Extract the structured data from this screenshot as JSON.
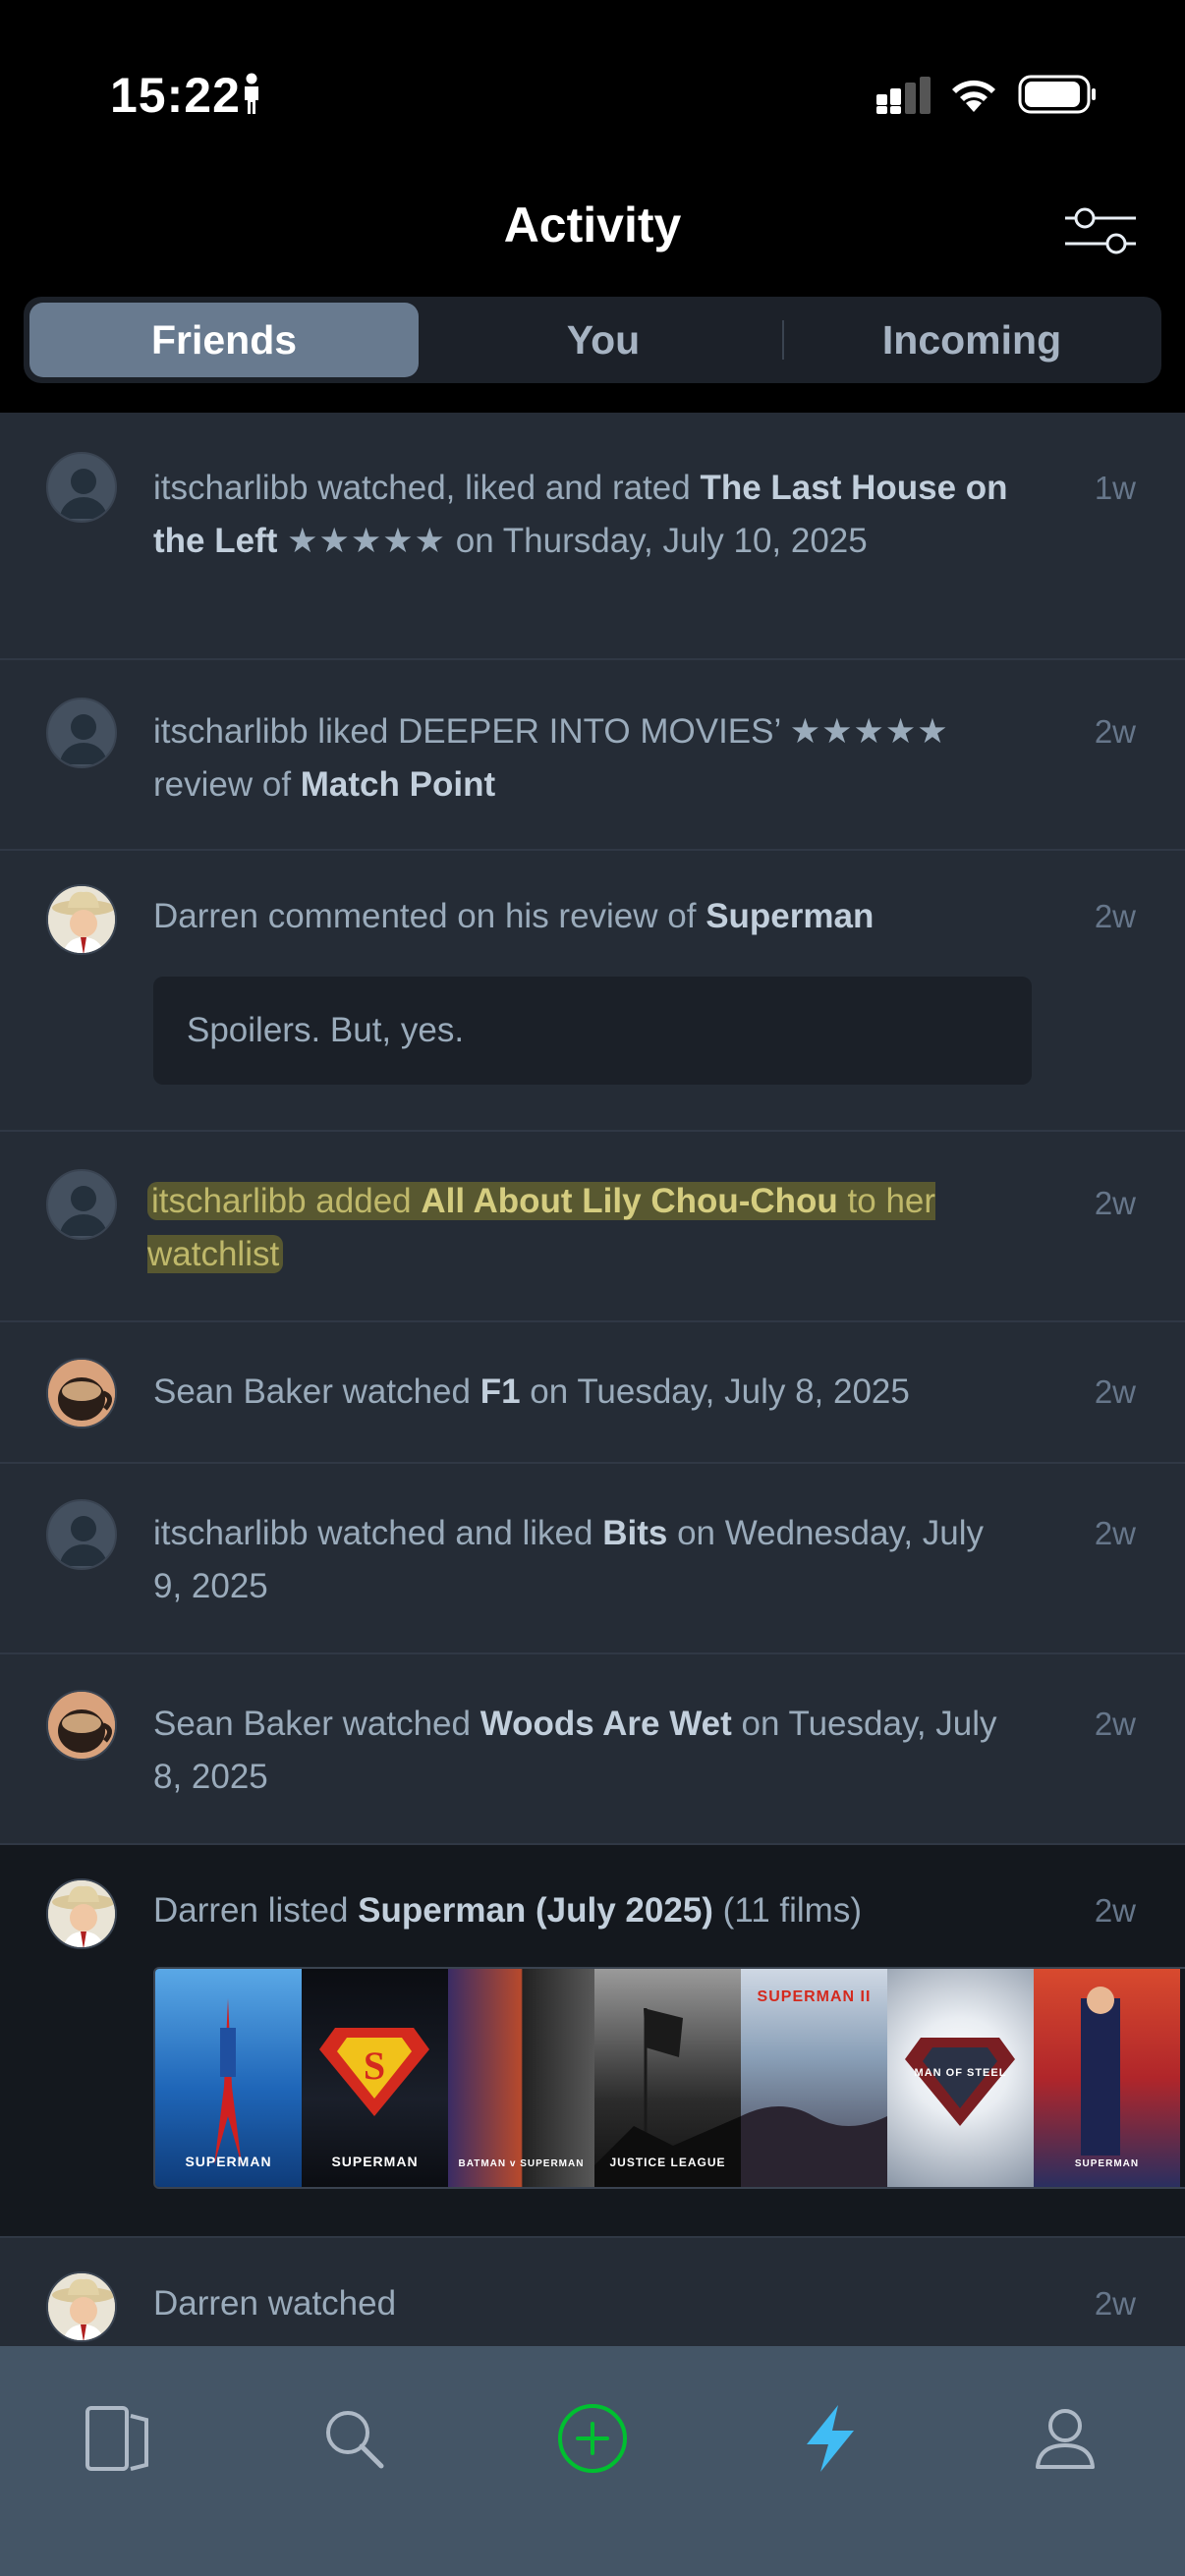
{
  "status_bar": {
    "time": "15:22"
  },
  "header": {
    "title": "Activity"
  },
  "tabs": [
    {
      "label": "Friends",
      "active": true
    },
    {
      "label": "You",
      "active": false
    },
    {
      "label": "Incoming",
      "active": false
    }
  ],
  "feed": [
    {
      "user": "itscharlibb",
      "text_a": " watched, liked and rated ",
      "title": "The Last House on the Left",
      "stars": "★★★★★",
      "text_b": " on Thursday, July 10, 2025",
      "time": "1w"
    },
    {
      "user": "itscharlibb",
      "text_a": " liked DEEPER INTO MOVIES’ ",
      "stars": "★★★★★",
      "text_b": " review of ",
      "title": "Match Point",
      "time": "2w"
    },
    {
      "user": "Darren",
      "text_a": " commented on his review of ",
      "title": "Superman",
      "comment": "Spoilers. But, yes.",
      "time": "2w"
    },
    {
      "user": "itscharlibb",
      "text_a": " added ",
      "title": "All About Lily Chou-Chou",
      "text_b": " to her watchlist",
      "time": "2w"
    },
    {
      "user": "Sean Baker",
      "text_a": " watched ",
      "title": "F1",
      "text_b": " on Tuesday, July 8, 2025",
      "time": "2w"
    },
    {
      "user": "itscharlibb",
      "text_a": " watched and liked ",
      "title": "Bits",
      "text_b": " on Wednesday, July 9, 2025",
      "time": "2w"
    },
    {
      "user": "Sean Baker",
      "text_a": " watched ",
      "title": "Woods Are Wet",
      "text_b": " on Tuesday, July 8, 2025",
      "time": "2w"
    },
    {
      "user": "Darren",
      "text_a": " listed ",
      "title": "Superman (July 2025)",
      "text_b": " (11 films)",
      "time": "2w",
      "posters": [
        "SUPERMAN",
        "SUPERMAN",
        "BATMAN v SUPERMAN",
        "JUSTICE LEAGUE",
        "SUPERMAN II",
        "MAN OF STEEL",
        "SUPERMAN"
      ]
    },
    {
      "user": "Darren",
      "text_a": " watched",
      "time": "2w"
    }
  ],
  "tab_bar": [
    {
      "icon": "films-icon"
    },
    {
      "icon": "search-icon"
    },
    {
      "icon": "add-icon",
      "color": "#00c030"
    },
    {
      "icon": "activity-icon",
      "color": "#40bcf4",
      "active": true
    },
    {
      "icon": "profile-icon"
    }
  ]
}
